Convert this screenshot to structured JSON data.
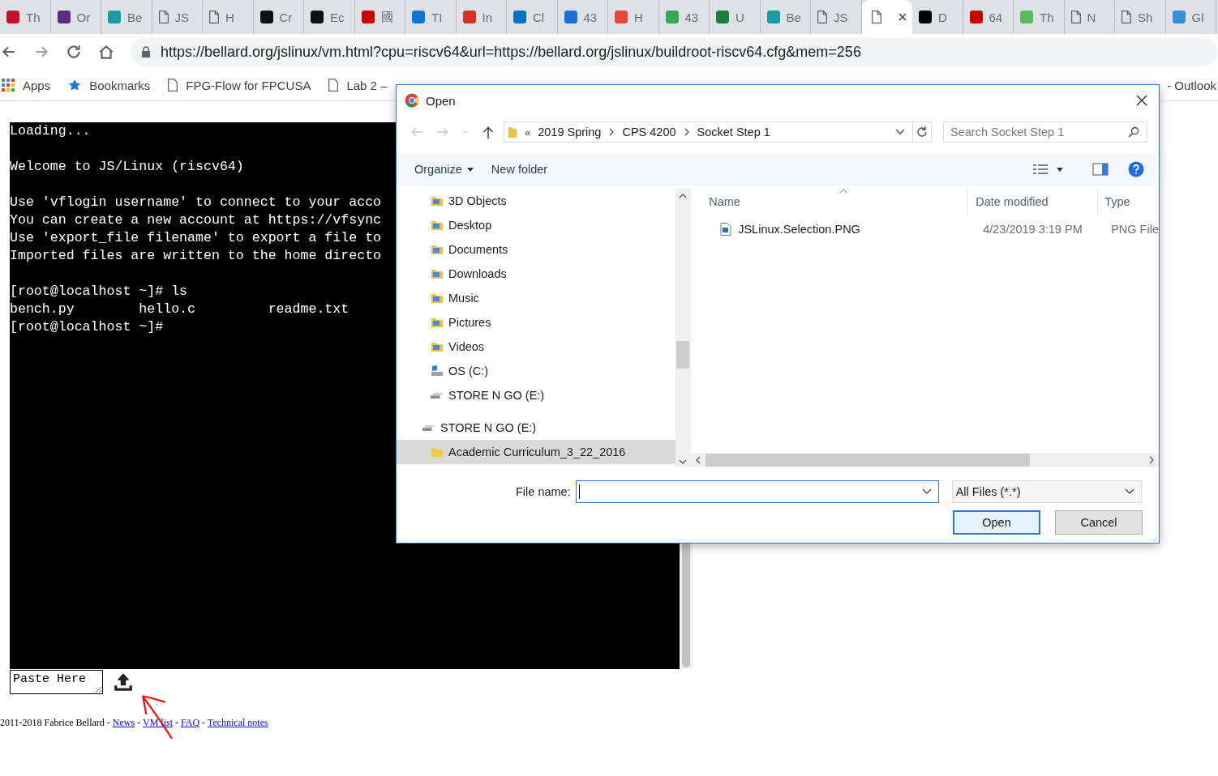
{
  "tabs": [
    {
      "label": "Th",
      "kind": "site",
      "color": "#c8102e",
      "selected": false
    },
    {
      "label": "Or",
      "kind": "site",
      "color": "#5a2d82",
      "selected": false
    },
    {
      "label": "Be",
      "kind": "site",
      "color": "#1a9ba1",
      "selected": false
    },
    {
      "label": "JS",
      "kind": "page",
      "selected": false
    },
    {
      "label": "H",
      "kind": "page",
      "selected": false
    },
    {
      "label": "Cr",
      "kind": "site",
      "color": "#111111",
      "selected": false
    },
    {
      "label": "Ec",
      "kind": "site",
      "color": "#111111",
      "selected": false
    },
    {
      "label": "國",
      "kind": "site",
      "color": "#cc0000",
      "selected": false
    },
    {
      "label": "TI",
      "kind": "site",
      "color": "#0a78d4",
      "selected": false
    },
    {
      "label": "In",
      "kind": "site",
      "color": "#d93025",
      "selected": false
    },
    {
      "label": "Cl",
      "kind": "site",
      "color": "#0072c6",
      "selected": false
    },
    {
      "label": "43",
      "kind": "site",
      "color": "#1e6fd9",
      "selected": false
    },
    {
      "label": "H",
      "kind": "site",
      "color": "#e8453c",
      "selected": false
    },
    {
      "label": "43",
      "kind": "site",
      "color": "#34a853",
      "selected": false
    },
    {
      "label": "U",
      "kind": "site",
      "color": "#188038",
      "selected": false
    },
    {
      "label": "Be",
      "kind": "site",
      "color": "#1a9ba1",
      "selected": false
    },
    {
      "label": "JS",
      "kind": "page",
      "selected": false
    },
    {
      "kind": "page",
      "selected": true
    },
    {
      "label": "D",
      "kind": "site",
      "color": "#000000",
      "selected": false
    },
    {
      "label": "64",
      "kind": "site",
      "color": "#cc0000",
      "selected": false
    },
    {
      "label": "Th",
      "kind": "site",
      "color": "#5cb85c",
      "selected": false
    },
    {
      "label": "N",
      "kind": "page",
      "selected": false
    },
    {
      "label": "Sh",
      "kind": "page",
      "selected": false
    },
    {
      "label": "Gl",
      "kind": "site",
      "color": "#3a8fd9",
      "selected": false
    }
  ],
  "address_bar": {
    "url": "https://bellard.org/jslinux/vm.html?cpu=riscv64&url=https://bellard.org/jslinux/buildroot-riscv64.cfg&mem=256"
  },
  "bookmarks": [
    {
      "label": "Apps",
      "kind": "apps"
    },
    {
      "label": "Bookmarks",
      "kind": "star"
    },
    {
      "label": "FPG-Flow for FPCUSA",
      "kind": "page"
    },
    {
      "label": "Lab 2 –",
      "kind": "page"
    },
    {
      "label": "- Outlook",
      "kind": "text"
    }
  ],
  "terminal": {
    "paragraphs": [
      [
        "Loading..."
      ],
      [
        "Welcome to JS/Linux (riscv64)"
      ],
      [
        "Use 'vflogin username' to connect to your acco",
        "You can create a new account at https://vfsync",
        "Use 'export_file filename' to export a file to",
        "Imported files are written to the home directo"
      ],
      [
        "[root@localhost ~]# ls",
        "bench.py        hello.c         readme.txt",
        "[root@localhost ~]#"
      ]
    ]
  },
  "paste_box": {
    "placeholder": "Paste Here"
  },
  "footer": {
    "parts": [
      {
        "kind": "text",
        "text": "2011-2018 Fabrice Bellard - "
      },
      {
        "kind": "link",
        "text": "News"
      },
      {
        "kind": "text",
        "text": " - "
      },
      {
        "kind": "link",
        "text": "VM list"
      },
      {
        "kind": "text",
        "text": " - "
      },
      {
        "kind": "link",
        "text": "FAQ"
      },
      {
        "kind": "text",
        "text": " - "
      },
      {
        "kind": "link",
        "text": "Technical notes"
      }
    ]
  },
  "dialog": {
    "title": "Open",
    "breadcrumb_overflow": "«",
    "breadcrumb": [
      "2019 Spring",
      "CPS 4200",
      "Socket Step 1"
    ],
    "search": {
      "placeholder": "Search Socket Step 1"
    },
    "toolbar": {
      "organize": "Organize",
      "new_folder": "New folder"
    },
    "nav_items": [
      {
        "label": "3D Objects",
        "kind": "folder",
        "selected": false
      },
      {
        "label": "Desktop",
        "kind": "folder",
        "selected": false
      },
      {
        "label": "Documents",
        "kind": "folder",
        "selected": false
      },
      {
        "label": "Downloads",
        "kind": "folder",
        "selected": false
      },
      {
        "label": "Music",
        "kind": "folder",
        "selected": false
      },
      {
        "label": "Pictures",
        "kind": "folder",
        "selected": false
      },
      {
        "label": "Videos",
        "kind": "folder",
        "selected": false
      },
      {
        "label": "OS (C:)",
        "kind": "os-drive",
        "selected": false
      },
      {
        "label": "STORE N GO (E:)",
        "kind": "usb-drive",
        "selected": false
      }
    ],
    "nav_tree": [
      {
        "label": "STORE N GO (E:)",
        "kind": "usb-drive",
        "selected": false,
        "children": [
          {
            "label": "Academic Curriculum_3_22_2016",
            "kind": "folder",
            "selected": true
          }
        ]
      }
    ],
    "columns": [
      "Name",
      "Date modified",
      "Type"
    ],
    "files": [
      {
        "name": "JSLinux.Selection.PNG",
        "date": "4/23/2019 3:19 PM",
        "type": "PNG File",
        "selected": false
      }
    ],
    "file_name_label": "File name:",
    "filter": "All Files (*.*)",
    "buttons": [
      "Open",
      "Cancel"
    ]
  }
}
